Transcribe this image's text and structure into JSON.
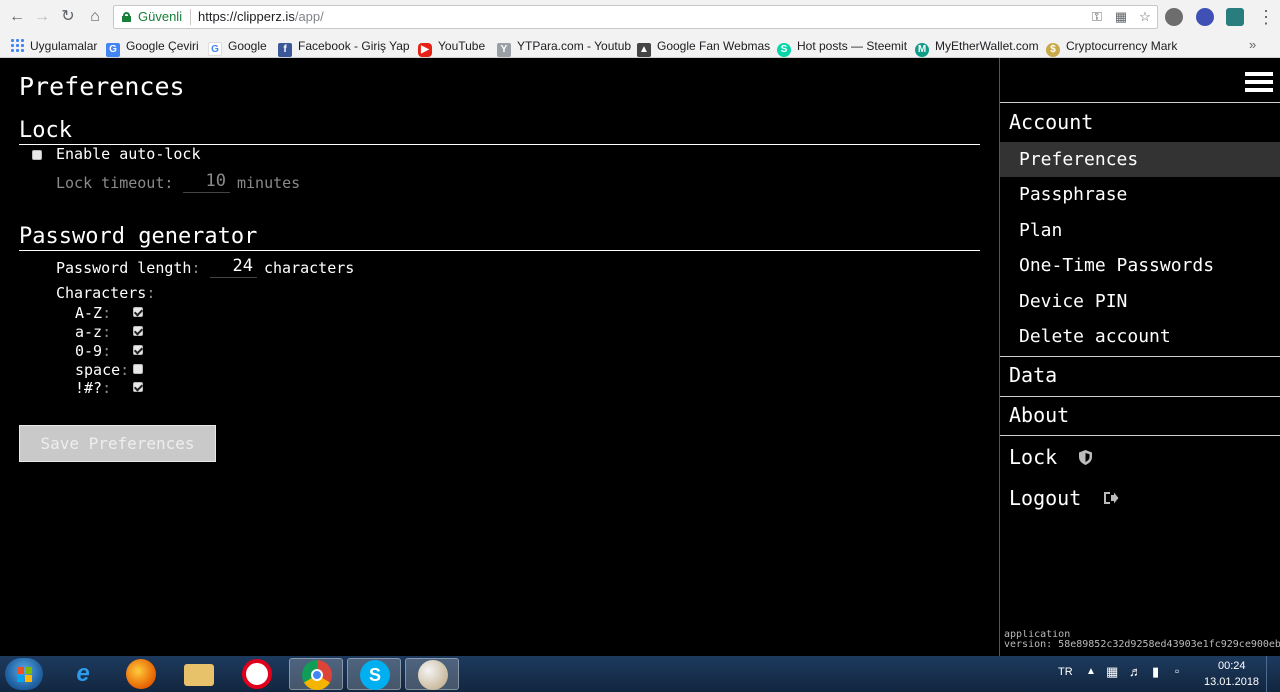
{
  "browser": {
    "secure_label": "Güvenli",
    "url_host": "https://clipperz.is",
    "url_path": "/app/",
    "bookmarks": [
      {
        "label": "Uygulamalar",
        "icon": "apps-icon"
      },
      {
        "label": "Google Çeviri",
        "icon": "google-translate-icon"
      },
      {
        "label": "Google",
        "icon": "google-icon"
      },
      {
        "label": "Facebook - Giriş Yap",
        "icon": "facebook-icon"
      },
      {
        "label": "YouTube",
        "icon": "youtube-icon"
      },
      {
        "label": "YTPara.com - Youtub",
        "icon": "ytpara-icon"
      },
      {
        "label": "Google Fan Webmas",
        "icon": "google-fan-icon"
      },
      {
        "label": "Hot posts — Steemit",
        "icon": "steemit-icon"
      },
      {
        "label": "MyEtherWallet.com",
        "icon": "myetherwallet-icon"
      },
      {
        "label": "Cryptocurrency Mark",
        "icon": "coin-icon"
      }
    ],
    "more_label": "»"
  },
  "main": {
    "title": "Preferences",
    "lock": {
      "title": "Lock",
      "autolock_label": "Enable auto-lock",
      "autolock_checked": false,
      "timeout_label": "Lock timeout",
      "timeout_colon": ":",
      "timeout_value": "10",
      "timeout_unit": "minutes"
    },
    "generator": {
      "title": "Password generator",
      "length_label": "Password length",
      "length_colon": ":",
      "length_value": "24",
      "length_unit": "characters",
      "characters_label": "Characters",
      "characters_colon": ":",
      "sets": [
        {
          "label": "A-Z",
          "checked": true
        },
        {
          "label": "a-z",
          "checked": true
        },
        {
          "label": "0-9",
          "checked": true
        },
        {
          "label": "space",
          "checked": false
        },
        {
          "label": "!#?",
          "checked": true
        }
      ],
      "set_colon": ":"
    },
    "save_label": "Save Preferences"
  },
  "sidebar": {
    "account_label": "Account",
    "account_items": [
      {
        "label": "Preferences",
        "active": true
      },
      {
        "label": "Passphrase",
        "active": false
      },
      {
        "label": "Plan",
        "active": false
      },
      {
        "label": "One-Time Passwords",
        "active": false
      },
      {
        "label": "Device PIN",
        "active": false
      },
      {
        "label": "Delete account",
        "active": false
      }
    ],
    "data_label": "Data",
    "about_label": "About",
    "lock_label": "Lock",
    "logout_label": "Logout",
    "version_line1": "application",
    "version_line2": "version: 58e89852c32d9258ed43903e1fc929ce900eb"
  },
  "taskbar": {
    "language": "TR",
    "time": "00:24",
    "date": "13.01.2018"
  },
  "colors": {
    "background": "#000000",
    "text": "#ffffff",
    "active_item": "#333333",
    "secure_green": "#188038"
  }
}
